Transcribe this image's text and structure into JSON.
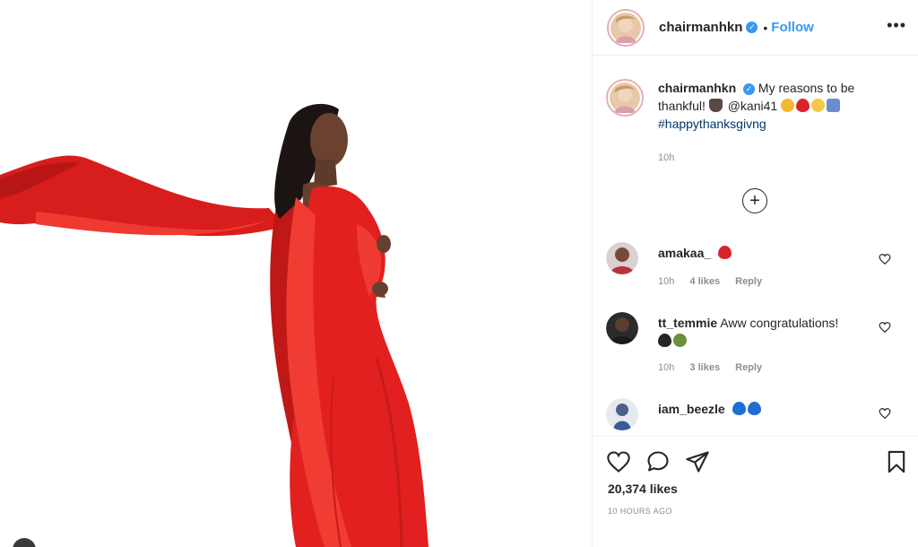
{
  "post": {
    "username": "chairmanhkn",
    "verified_mark": "✓",
    "separator": "•",
    "follow_label": "Follow",
    "more_label": "•••",
    "caption": {
      "username": "chairmanhkn",
      "text_line1": " My reasons to be thankful!",
      "mention": "@kani41",
      "hashtag": "#happythanksgivng",
      "time": "10h",
      "emojis": [
        "praying-hands",
        "star-struck-face",
        "red-heart",
        "smiling-face",
        "family"
      ]
    },
    "load_more_label": "+",
    "comments": [
      {
        "username": "amakaa_",
        "text": "",
        "emojis": [
          "red-heart"
        ],
        "time": "10h",
        "likes": "4 likes",
        "reply": "Reply"
      },
      {
        "username": "tt_temmie",
        "text": "Aww congratulations!",
        "emojis": [
          "black-heart",
          "shamrock"
        ],
        "time": "10h",
        "likes": "3 likes",
        "reply": "Reply"
      },
      {
        "username": "iam_beezle",
        "text": "",
        "emojis": [
          "blue-heart",
          "blue-heart"
        ]
      }
    ],
    "likes": "20,374 likes",
    "timestamp": "10 HOURS AGO"
  },
  "icons": {
    "like": "heart-outline-icon",
    "comment": "speech-bubble-icon",
    "share": "paper-plane-icon",
    "save": "bookmark-icon",
    "comment_like": "heart-small-icon",
    "load_more": "plus-circle-icon"
  },
  "colors": {
    "link_blue": "#3897f0",
    "hashtag": "#00376b",
    "muted": "#8e8e8e",
    "dress_red": "#e2201f"
  }
}
